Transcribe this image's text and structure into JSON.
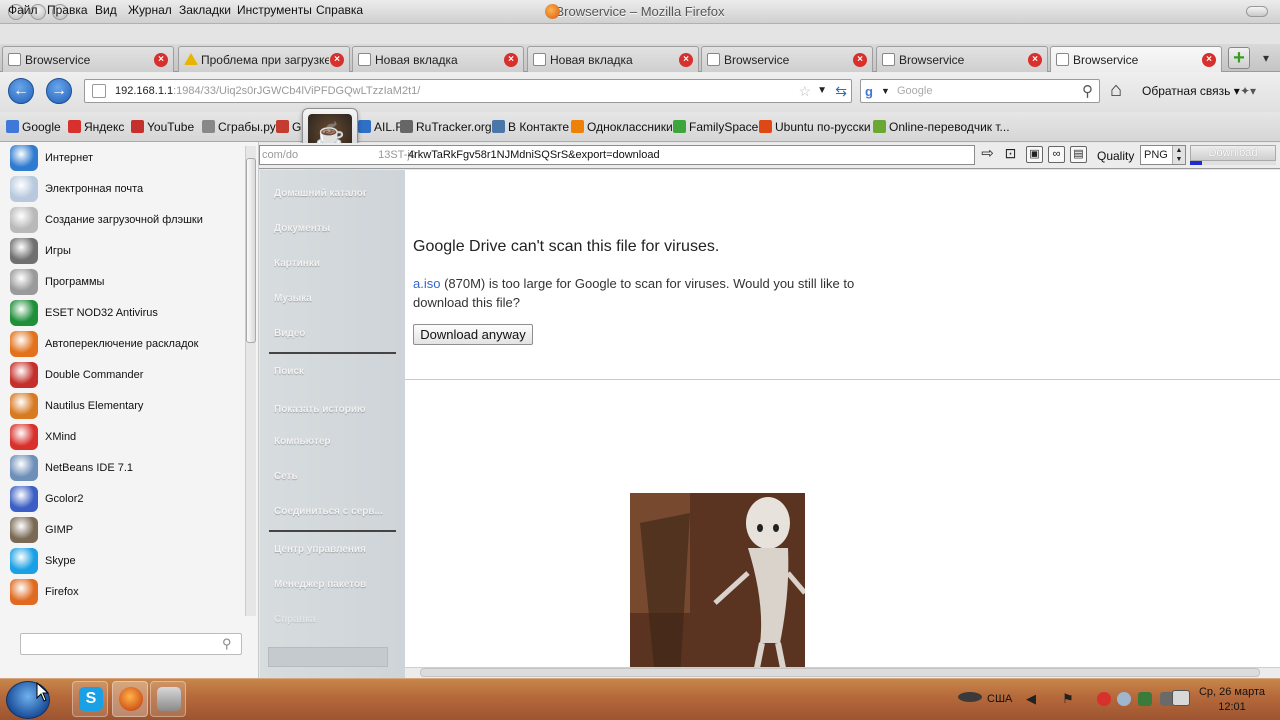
{
  "window": {
    "title": "Browservice – Mozilla Firefox"
  },
  "menu": [
    "Файл",
    "Правка",
    "Вид",
    "Журнал",
    "Закладки",
    "Инструменты",
    "Справка"
  ],
  "tabs": [
    {
      "label": "Browservice",
      "active": false,
      "warn": false
    },
    {
      "label": "Проблема при загрузке ...",
      "active": false,
      "warn": true
    },
    {
      "label": "Новая вкладка",
      "active": false,
      "warn": false
    },
    {
      "label": "Новая вкладка",
      "active": false,
      "warn": false
    },
    {
      "label": "Browservice",
      "active": false,
      "warn": false
    },
    {
      "label": "Browservice",
      "active": false,
      "warn": false
    },
    {
      "label": "Browservice",
      "active": true,
      "warn": false
    }
  ],
  "nav": {
    "url_host": "192.168.1.1",
    "url_rest": ":1984/33/Uiq2s0rJGWCb4lViPFDGQwLTzzIaM2t1/",
    "search_placeholder": "Google",
    "feedback": "Обратная связь"
  },
  "bookmarks": [
    {
      "label": "Google",
      "color": "#3f78d8"
    },
    {
      "label": "Яндекс",
      "color": "#d8302c"
    },
    {
      "label": "YouTube",
      "color": "#c4302b"
    },
    {
      "label": "Сграбы.ру",
      "color": "#888888"
    },
    {
      "label": "Gr",
      "color": "#c43c2f"
    },
    {
      "label": "AIL.RU",
      "color": "#2f6fc4"
    },
    {
      "label": "RuTracker.org",
      "color": "#666666"
    },
    {
      "label": "В Контакте",
      "color": "#4a76a8"
    },
    {
      "label": "Одноклассники",
      "color": "#ee8208"
    },
    {
      "label": "FamilySpace",
      "color": "#3ca63c"
    },
    {
      "label": "Ubuntu по-русски",
      "color": "#dd4814"
    },
    {
      "label": "Online-переводчик т...",
      "color": "#6aa834"
    }
  ],
  "apps": [
    {
      "label": "Интернет",
      "color": "#2f7bd0"
    },
    {
      "label": "Электронная почта",
      "color": "#b8c9dd"
    },
    {
      "label": "Создание загрузочной флэшки",
      "color": "#b9b9b9"
    },
    {
      "label": "Игры",
      "color": "#707070"
    },
    {
      "label": "Программы",
      "color": "#9a9a9a"
    },
    {
      "label": "ESET NOD32 Antivirus",
      "color": "#1f8f3a"
    },
    {
      "label": "Автопереключение раскладок",
      "color": "#e2721b"
    },
    {
      "label": "Double Commander",
      "color": "#c4302b"
    },
    {
      "label": "Nautilus Elementary",
      "color": "#d77a22"
    },
    {
      "label": "XMind",
      "color": "#d8302c"
    },
    {
      "label": "NetBeans IDE 7.1",
      "color": "#6d8fb8"
    },
    {
      "label": "Gcolor2",
      "color": "#3b5fc4"
    },
    {
      "label": "GIMP",
      "color": "#7a6a55"
    },
    {
      "label": "Skype",
      "color": "#1aa0e4"
    },
    {
      "label": "Firefox",
      "color": "#e06a1f"
    }
  ],
  "places": [
    "Домашний каталог",
    "Документы",
    "Картинки",
    "Музыка",
    "Видео",
    "Поиск",
    "Показать историю",
    "Компьютер",
    "Сеть",
    "Соединиться с серв...",
    "Центр управления",
    "Менеджер пакетов",
    "Справка"
  ],
  "converter": {
    "url_prefix": "com/do",
    "url_hidden": "13ST-j0",
    "url": "4rkwTaRkFgv58r1NJMdniSQSrS&export=download",
    "quality_label": "Quality",
    "quality_value": "PNG",
    "download_label": "Download",
    "download_progress": 0.14
  },
  "page": {
    "title": "Google Drive can't scan this file for viruses.",
    "file_link": "a.iso",
    "message": " (870M) is too large for Google to scan for viruses. Would you still like to download this file?",
    "button": "Download anyway"
  },
  "taskbar": {
    "lang": "США",
    "clock_date": "Ср, 26 марта",
    "clock_time": "12:01"
  },
  "colors": {
    "accent": "#3366cc",
    "close": "#d8302c",
    "taskbar": "#b5683a"
  }
}
